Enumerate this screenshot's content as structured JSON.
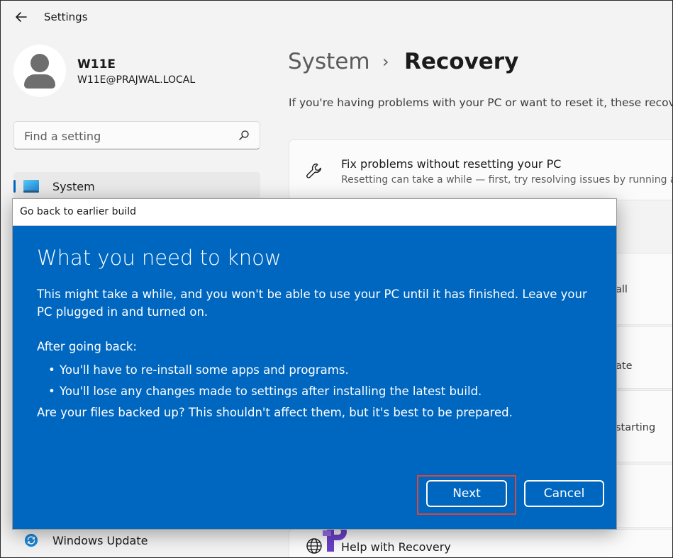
{
  "window": {
    "title": "Settings"
  },
  "profile": {
    "name": "W11E",
    "email": "W11E@PRAJWAL.LOCAL"
  },
  "search": {
    "placeholder": "Find a setting"
  },
  "nav": {
    "items": [
      {
        "label": "System",
        "selected": true
      },
      {
        "label": "Windows Update",
        "selected": false
      }
    ]
  },
  "breadcrumb": {
    "parent": "System",
    "separator": "›",
    "current": "Recovery"
  },
  "main": {
    "intro": "If you're having problems with your PC or want to reset it, these recove",
    "fix_card": {
      "title": "Fix problems without resetting your PC",
      "subtitle": "Resetting can take a while — first, try resolving issues by running a tro"
    },
    "fragments": [
      "all",
      "ate",
      "starting"
    ],
    "help": {
      "label": "Help with Recovery"
    }
  },
  "dialog": {
    "title": "Go back to earlier build",
    "heading": "What you need to know",
    "paragraph": "This might take a while, and you won't be able to use your PC until it has finished. Leave your PC plugged in and turned on.",
    "after_heading": "After going back:",
    "bullets": [
      "You'll have to re-install some apps and programs.",
      "You'll lose any changes made to settings after installing the latest build."
    ],
    "files_note": "Are your files backed up? This shouldn't affect them, but it's best to be prepared.",
    "buttons": {
      "next": "Next",
      "cancel": "Cancel"
    }
  },
  "colors": {
    "accent": "#0067c0",
    "dialog_bg": "#0067c0",
    "highlight": "#d9463a",
    "window_bg": "#f3f3f3"
  },
  "icons": [
    "back-arrow-icon",
    "search-icon",
    "system-display-icon",
    "windows-update-icon",
    "wrench-icon",
    "globe-icon"
  ]
}
